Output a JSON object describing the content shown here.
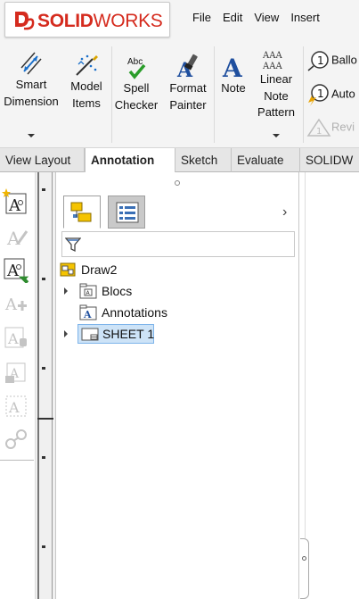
{
  "app": {
    "logo_brand": "SOLIDWORKS",
    "logo_bold": "SOLID",
    "logo_thin": "WORKS",
    "logo_icon": "ds-logo-icon"
  },
  "menu": [
    "File",
    "Edit",
    "View",
    "Insert"
  ],
  "ribbon": {
    "smart_dimension": "Smart\nDimension",
    "model_items": "Model\nItems",
    "spell_checker": "Spell\nChecker",
    "format_painter": "Format\nPainter",
    "note": "Note",
    "linear_note_pattern": "Linear\nNote\nPattern",
    "balloon": "Ballo",
    "auto_balloon": "Auto",
    "revision": "Revi",
    "spell_checker_icon_text": "Abc",
    "linear_note_icon_text": "AAA"
  },
  "tabs": [
    "View Layout",
    "Annotation",
    "Sketch",
    "Evaluate",
    "SOLIDW"
  ],
  "active_tab": "Annotation",
  "tree": {
    "root": "Draw2",
    "items": [
      {
        "label": "Blocs",
        "expandable": true
      },
      {
        "label": "Annotations",
        "expandable": false
      },
      {
        "label": "SHEET 1",
        "expandable": true,
        "selected": true
      }
    ]
  },
  "colors": {
    "brand_red": "#d52b1e",
    "selection": "#cde3f7",
    "selection_border": "#7eb4ea"
  }
}
